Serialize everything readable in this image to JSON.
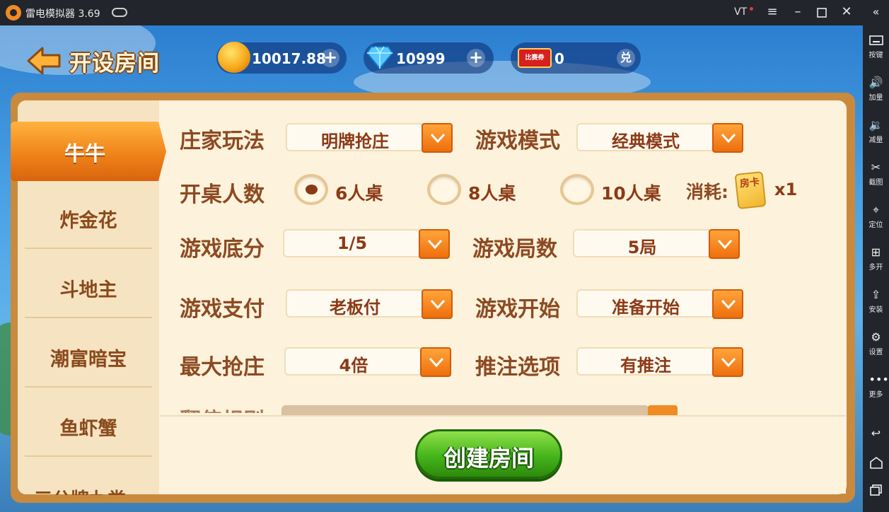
{
  "titlebar": {
    "app_title": "雷电模拟器 3.69",
    "vt": "VT",
    "menu_icon": "hamburger-icon",
    "minimize_icon": "minimize-icon",
    "maximize_icon": "maximize-icon",
    "close_icon": "close-icon"
  },
  "sidebar": {
    "collapse_icon": "double-chevron-left-icon",
    "items": [
      {
        "icon": "keyboard-icon",
        "label": "按键"
      },
      {
        "icon": "volume-up-icon",
        "label": "加量"
      },
      {
        "icon": "volume-down-icon",
        "label": "减量"
      },
      {
        "icon": "scissors-icon",
        "label": "截图"
      },
      {
        "icon": "location-pin-icon",
        "label": "定位"
      },
      {
        "icon": "multi-window-icon",
        "label": "多开"
      },
      {
        "icon": "apk-install-icon",
        "label": "安装"
      },
      {
        "icon": "gear-icon",
        "label": "设置"
      },
      {
        "icon": "more-dots-icon",
        "label": "更多"
      }
    ],
    "nav_icons": [
      "back-icon",
      "home-icon",
      "recent-apps-icon"
    ]
  },
  "header": {
    "title": "开设房间",
    "gold": "10017.88",
    "diamonds": "10999",
    "ticket_label": "比赛券",
    "tickets": "0",
    "exchange": "兑"
  },
  "nav": {
    "active": "牛牛",
    "items": [
      "炸金花",
      "斗地主",
      "潮富暗宝",
      "鱼虾蟹"
    ],
    "partial_item": "三公牌九类"
  },
  "form": {
    "banker_mode": {
      "label": "庄家玩法",
      "value": "明牌抢庄"
    },
    "game_mode": {
      "label": "游戏模式",
      "value": "经典模式"
    },
    "players": {
      "label": "开桌人数",
      "options": [
        "6人桌",
        "8人桌",
        "10人桌"
      ],
      "selected": "6人桌"
    },
    "cost": {
      "label": "消耗:",
      "card": "房卡",
      "multiplier": "x1"
    },
    "base_score": {
      "label": "游戏底分",
      "value": "1/5"
    },
    "rounds": {
      "label": "游戏局数",
      "value": "5局"
    },
    "payment": {
      "label": "游戏支付",
      "value": "老板付"
    },
    "start": {
      "label": "游戏开始",
      "value": "准备开始"
    },
    "max_grab": {
      "label": "最大抢庄",
      "value": "4倍"
    },
    "bet_option": {
      "label": "推注选项",
      "value": "有推注"
    },
    "partial_label": "翻倍规则"
  },
  "create_button": "创建房间"
}
